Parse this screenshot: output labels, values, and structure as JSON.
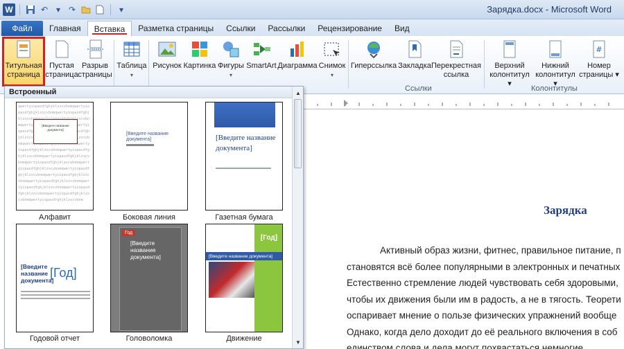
{
  "window": {
    "title": "Зарядка.docx - Microsoft Word"
  },
  "tabs": [
    "Файл",
    "Главная",
    "Вставка",
    "Разметка страницы",
    "Ссылки",
    "Рассылки",
    "Рецензирование",
    "Вид"
  ],
  "ribbon": {
    "buttons": [
      {
        "label1": "Титульная",
        "label2": "страница",
        "arrow": "▾",
        "icon": "cover-page-icon"
      },
      {
        "label1": "Пустая",
        "label2": "страница",
        "icon": "blank-page-icon"
      },
      {
        "label1": "Разрыв",
        "label2": "страницы",
        "icon": "page-break-icon"
      },
      {
        "label1": "Таблица",
        "label2": "▾",
        "icon": "table-icon"
      },
      {
        "label1": "Рисунок",
        "label2": "",
        "icon": "picture-icon"
      },
      {
        "label1": "Картинка",
        "label2": "",
        "icon": "clipart-icon"
      },
      {
        "label1": "Фигуры",
        "label2": "▾",
        "icon": "shapes-icon"
      },
      {
        "label1": "SmartArt",
        "label2": "",
        "icon": "smartart-icon"
      },
      {
        "label1": "Диаграмма",
        "label2": "",
        "icon": "chart-icon"
      },
      {
        "label1": "Снимок",
        "label2": "▾",
        "icon": "screenshot-icon"
      },
      {
        "label1": "Гиперссылка",
        "label2": "",
        "icon": "hyperlink-icon"
      },
      {
        "label1": "Закладка",
        "label2": "",
        "icon": "bookmark-icon"
      },
      {
        "label1": "Перекрестная",
        "label2": "ссылка",
        "icon": "cross-reference-icon"
      },
      {
        "label1": "Верхний",
        "label2": "колонтитул ▾",
        "icon": "header-icon"
      },
      {
        "label1": "Нижний",
        "label2": "колонтитул ▾",
        "icon": "footer-icon"
      },
      {
        "label1": "Номер",
        "label2": "страницы ▾",
        "icon": "page-number-icon"
      }
    ],
    "groups": {
      "links": "Ссылки",
      "headers": "Колонтитулы"
    }
  },
  "gallery": {
    "header": "Встроенный",
    "tiles": [
      {
        "label": "Алфавит"
      },
      {
        "label": "Боковая линия"
      },
      {
        "label": "Газетная бумага"
      },
      {
        "label": "Годовой отчет"
      },
      {
        "label": "Головоломка"
      },
      {
        "label": "Движение"
      }
    ],
    "alpha_text": "qwertyiopasdfghjklzxcvbnmqwertyiopasdfghjklzxcvbnmqwertyiopasdfghjklzxcvbnmqwertyiopasdfghjklzxcvbnmqwertyiopasdfghjklzxcvbnmqwertyiopasdfghjklzxcvbnmqwertyiopasdfghjklzxcvbnmqwertyiopasdfghjklzxcvbnmqwertyiopasdfghjklzxcvbnmqwertyiopasdfghjklzxcvbnmqwertyiopasdfghjklzxcvbnmqwertyiopasdfghjklzxcvbnmqwertyiopasdfghjklzxcvbnmqwertyiopasdfghjklzxcvbnmqwertyiopasdfghjklzxcvbnmqwertyiopasdfghjklzxcvbnmqwertyiopasdfghjklzxcvbnmqwertyiopasdfghjklzxcvbnmqwertyiopasdfghjklzxcvbnmqwertyiopasdfghjklzxcvbnmqwertyiopasdfghjklzxcvbnm",
    "alpha_box": "[Введите название документа]",
    "doc_title_placeholder": "[Введите название документа]",
    "puzzle_title_placeholder": "[Введите название документа]",
    "motion_title_placeholder": "[Введите название документа]",
    "year_placeholder": "[Год]",
    "news_title": "[Введите название документа]",
    "puzzle_tag": "Год"
  },
  "document": {
    "title": "Зарядка",
    "lines": [
      "Активный образ жизни, фитнес, правильное питание, п",
      "становятся всё более популярными в электронных и печатных",
      "Естественно стремление людей чувствовать себя здоровыми,",
      "чтобы их движения были им в радость, а не в тягость. Теорети",
      "оспаривает мнение о пользе физических упражнений вообще",
      "Однако, когда дело доходит до её реального включения в соб",
      "единством слова и дела могут похвастаться немногие."
    ]
  },
  "colors": {
    "accent": "#2b5797",
    "highlight": "#d81e1e",
    "ribbon_bg": "#e9f0f9"
  }
}
